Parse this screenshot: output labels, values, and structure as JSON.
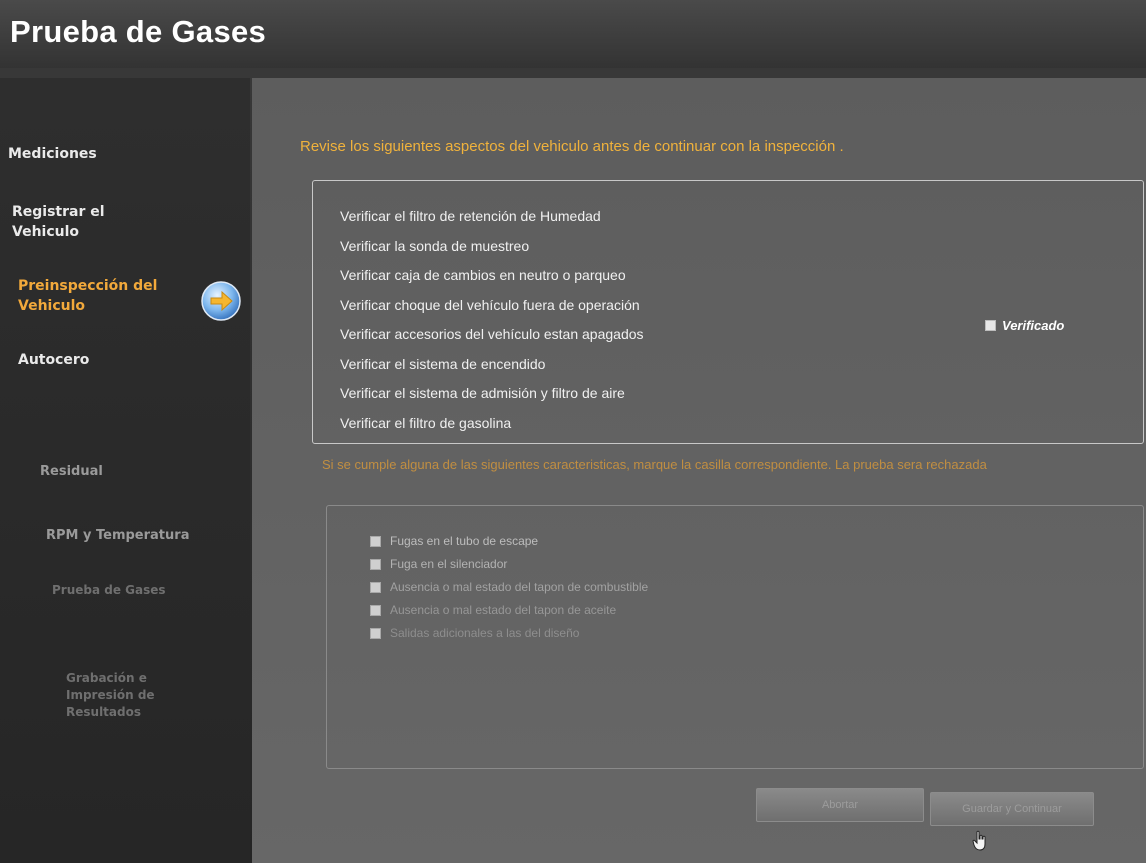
{
  "app": {
    "title": "Prueba de Gases"
  },
  "sidebar": {
    "items": [
      {
        "label": "Mediciones",
        "state": "done"
      },
      {
        "label": "Registrar el Vehiculo",
        "state": "done"
      },
      {
        "label": "Preinspección del Vehiculo",
        "state": "active"
      },
      {
        "label": "Autocero",
        "state": "done"
      },
      {
        "label": "Residual",
        "state": "pending"
      },
      {
        "label": "RPM y Temperatura",
        "state": "pending"
      },
      {
        "label": "Prueba de Gases",
        "state": "pending"
      },
      {
        "label": "Grabación e Impresión de Resultados",
        "state": "pending"
      }
    ],
    "current_indicator_icon": "arrow-right-circle-icon"
  },
  "main": {
    "instruction": "Revise los siguientes aspectos del vehiculo antes de continuar con la inspección .",
    "checklist": [
      "Verificar el filtro de retención de Humedad",
      "Verificar la sonda de muestreo",
      "Verificar caja de cambios en neutro o parqueo",
      "Verificar choque del vehículo fuera de operación",
      "Verificar accesorios del vehículo estan apagados",
      "Verificar el sistema de encendido",
      "Verificar el sistema de admisión y filtro de aire",
      "Verificar el filtro de gasolina"
    ],
    "verified_label": "Verificado",
    "rejection_instruction": "Si se cumple alguna de las siguientes caracteristicas, marque la casilla correspondiente. La prueba sera rechazada",
    "rejection_items": [
      "Fugas en el tubo de escape",
      "Fuga en el silenciador",
      "Ausencia o mal estado del tapon de combustible",
      "Ausencia o mal estado del tapon de aceite",
      "Salidas adicionales a las del diseño"
    ]
  },
  "footer": {
    "abort_label": "Abortar",
    "save_label": "Guardar y Continuar"
  },
  "colors": {
    "accent": "#f0b23c",
    "panel_bg": "#626262",
    "sidebar_bg": "#2a2a2a",
    "text": "#f0f0f0"
  }
}
